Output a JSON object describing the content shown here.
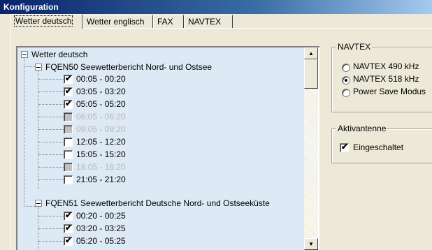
{
  "window": {
    "title": "Konfiguration"
  },
  "tabs": [
    {
      "label": "Wetter deutsch",
      "active": true
    },
    {
      "label": "Wetter englisch",
      "active": false
    },
    {
      "label": "FAX",
      "active": false
    },
    {
      "label": "NAVTEX",
      "active": false
    }
  ],
  "tree": {
    "root": "Wetter deutsch",
    "groups": [
      {
        "label": "FQEN50 Seewetterbericht Nord- und Ostsee",
        "items": [
          {
            "label": "00:05 - 00:20",
            "checked": true,
            "enabled": true
          },
          {
            "label": "03:05 - 03:20",
            "checked": true,
            "enabled": true
          },
          {
            "label": "05:05 - 05:20",
            "checked": true,
            "enabled": true
          },
          {
            "label": "06:05 - 06:20",
            "checked": false,
            "enabled": false
          },
          {
            "label": "09:05 - 09:20",
            "checked": false,
            "enabled": false
          },
          {
            "label": "12:05 - 12:20",
            "checked": false,
            "enabled": true
          },
          {
            "label": "15:05 - 15:20",
            "checked": false,
            "enabled": true
          },
          {
            "label": "18:05 - 18:20",
            "checked": false,
            "enabled": false
          },
          {
            "label": "21:05 - 21:20",
            "checked": false,
            "enabled": true
          }
        ]
      },
      {
        "label": "FQEN51 Seewetterbericht Deutsche Nord- und Ostseeküste",
        "items": [
          {
            "label": "00:20 - 00:25",
            "checked": true,
            "enabled": true
          },
          {
            "label": "03:20 - 03:25",
            "checked": true,
            "enabled": true
          },
          {
            "label": "05:20 - 05:25",
            "checked": true,
            "enabled": true
          }
        ]
      }
    ]
  },
  "navtex": {
    "title": "NAVTEX",
    "options": [
      {
        "label": "NAVTEX 490 kHz",
        "selected": false
      },
      {
        "label": "NAVTEX 518 kHz",
        "selected": true
      },
      {
        "label": "Power Save Modus",
        "selected": false
      }
    ]
  },
  "antenna": {
    "title": "Aktivantenne",
    "checkbox_label": "Eingeschaltet",
    "checked": true
  },
  "icons": {
    "collapse": "minus-expander-icon",
    "scroll_up": "arrow-up-icon",
    "scroll_down": "arrow-down-icon"
  }
}
